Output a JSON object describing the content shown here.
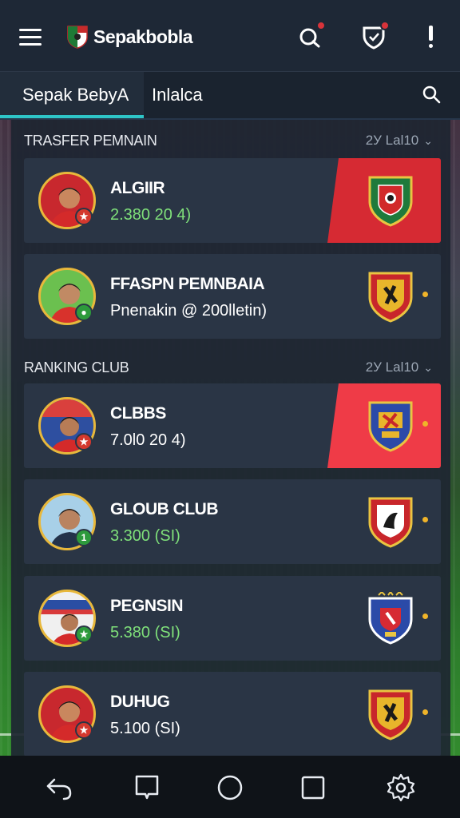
{
  "app": {
    "title": "Sepakbobla"
  },
  "tabs": [
    {
      "label": "Sepak BebyA"
    },
    {
      "label": "Inlalca"
    }
  ],
  "sections": {
    "transfer": {
      "heading": "TRASFER PEMNAIN",
      "sort": "2У Lal10"
    },
    "ranking": {
      "heading": "RANKING CLUB",
      "sort": "2У Lal10"
    }
  },
  "cards": [
    {
      "name": "ALGIIR",
      "value": "2.380 20 4)",
      "highlight": true
    },
    {
      "name": "FFASPN PEMNBAIA",
      "value": "Pnenakin @ 200lletin)",
      "highlight": false
    },
    {
      "name": "CLBBS",
      "value": "7.0l0 20 4)",
      "highlight": true
    },
    {
      "name": "GLOUB CLUB",
      "value": "3.300 (SI)",
      "highlight": false
    },
    {
      "name": "PEGNSIN",
      "value": "5.380 (SI)",
      "highlight": false
    },
    {
      "name": "DUHUG",
      "value": "5.100 (SI)",
      "highlight": false
    }
  ],
  "icons": {
    "menu": "hamburger-icon",
    "logo": "club-logo-icon",
    "alerts": "notification-icon",
    "shield": "shield-icon",
    "more": "exclamation-icon",
    "search": "search-icon"
  },
  "colors": {
    "accent": "#2ec5c8",
    "highlight_red": "#d62a33",
    "value_green": "#7fe07a",
    "badge_red": "#d8333a"
  },
  "nav": [
    "back-icon",
    "recents-icon",
    "home-icon",
    "overview-icon",
    "settings-icon"
  ]
}
